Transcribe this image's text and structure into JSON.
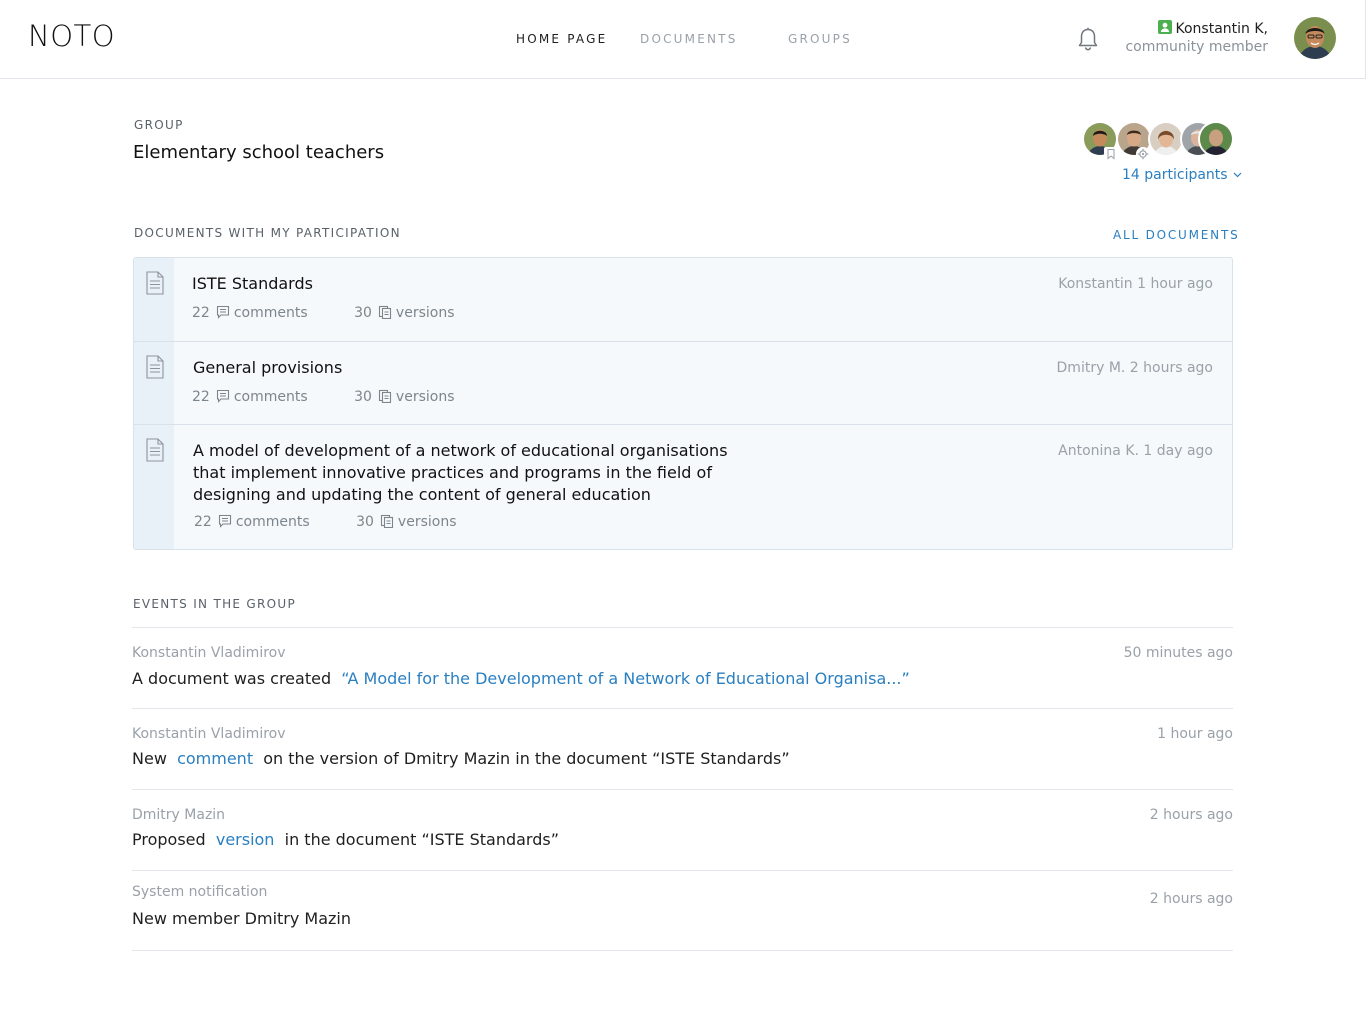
{
  "header": {
    "logo": "NOTO",
    "nav": [
      {
        "label": "HOME PAGE",
        "active": true
      },
      {
        "label": "DOCUMENTS",
        "active": false
      },
      {
        "label": "GROUPS",
        "active": false
      }
    ],
    "user_name": "Konstantin K,",
    "user_role": "community member"
  },
  "group": {
    "label": "GROUP",
    "title": "Elementary school teachers",
    "participants_link": "14 participants"
  },
  "documents_section": {
    "title": "DOCUMENTS WITH MY PARTICIPATION",
    "all_link": "ALL DOCUMENTS",
    "items": [
      {
        "title": "ISTE Standards",
        "comments_count": "22",
        "comments_label": "comments",
        "versions_count": "30",
        "versions_label": "versions",
        "author_time": "Konstantin 1 hour ago"
      },
      {
        "title": "General provisions",
        "comments_count": "22",
        "comments_label": "comments",
        "versions_count": "30",
        "versions_label": "versions",
        "author_time": "Dmitry M. 2 hours ago"
      },
      {
        "title_lines": [
          "A model of development of a network of educational organisations",
          "that implement innovative practices and programs in the field of",
          "designing and updating the content of general education"
        ],
        "comments_count": "22",
        "comments_label": "comments",
        "versions_count": "30",
        "versions_label": "versions",
        "author_time": "Antonina K. 1 day ago"
      }
    ]
  },
  "events_section": {
    "title": "EVENTS IN THE GROUP",
    "items": [
      {
        "author": "Konstantin Vladimirov",
        "time": "50 minutes ago",
        "pre": "A document was created",
        "link": "“A Model for the Development of a Network of Educational Organisa...”",
        "post": ""
      },
      {
        "author": "Konstantin Vladimirov",
        "time": "1 hour ago",
        "pre": "New",
        "link": "comment",
        "post": "on the version of Dmitry Mazin in the document “ISTE Standards”"
      },
      {
        "author": "Dmitry Mazin",
        "time": "2 hours ago",
        "pre": "Proposed",
        "link": "version",
        "post": "in the document “ISTE Standards”"
      },
      {
        "author": "System notification",
        "time": "2 hours ago",
        "pre": "New member Dmitry Mazin",
        "link": "",
        "post": ""
      }
    ]
  },
  "colors": {
    "accent": "#2a7fc1",
    "muted": "#9aa1a8",
    "doc_bg": "#f5f9fc",
    "doc_side": "#e9f1f8",
    "user_badge": "#4caf50"
  }
}
